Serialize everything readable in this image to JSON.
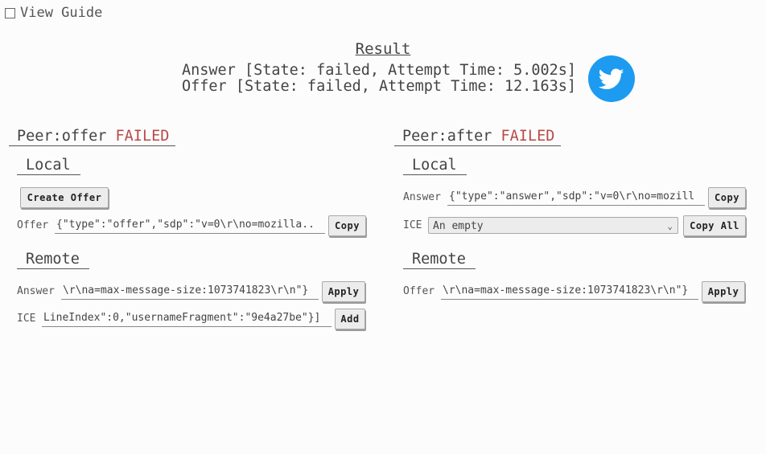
{
  "guide": {
    "label": "View Guide"
  },
  "result": {
    "title": "Result",
    "answer_line": "Answer [State: failed, Attempt Time: 5.002s]",
    "offer_line": "Offer [State: failed, Attempt Time: 12.163s]",
    "icon": "twitter-bird-icon",
    "icon_color": "#1d9bf0"
  },
  "peer_offer": {
    "title": "Peer:offer",
    "status": "FAILED",
    "local": {
      "heading": "Local",
      "create_offer_button": "Create Offer",
      "offer_label": "Offer",
      "offer_value": "{\"type\":\"offer\",\"sdp\":\"v=0\\r\\no=mozilla..",
      "copy_button": "Copy"
    },
    "remote": {
      "heading": "Remote",
      "answer_label": "Answer",
      "answer_value": "\\r\\na=max-message-size:1073741823\\r\\n\"}",
      "apply_button": "Apply",
      "ice_label": "ICE",
      "ice_value": "LineIndex\":0,\"usernameFragment\":\"9e4a27be\"}]",
      "add_button": "Add"
    }
  },
  "peer_after": {
    "title": "Peer:after",
    "status": "FAILED",
    "local": {
      "heading": "Local",
      "answer_label": "Answer",
      "answer_value": "{\"type\":\"answer\",\"sdp\":\"v=0\\r\\no=mozill",
      "copy_button": "Copy",
      "ice_label": "ICE",
      "ice_selected": "An empty",
      "copy_all_button": "Copy All"
    },
    "remote": {
      "heading": "Remote",
      "offer_label": "Offer",
      "offer_value": "\\r\\na=max-message-size:1073741823\\r\\n\"}",
      "apply_button": "Apply"
    }
  },
  "colors": {
    "failed": "#b94a48",
    "background": "#fcfcfc"
  }
}
